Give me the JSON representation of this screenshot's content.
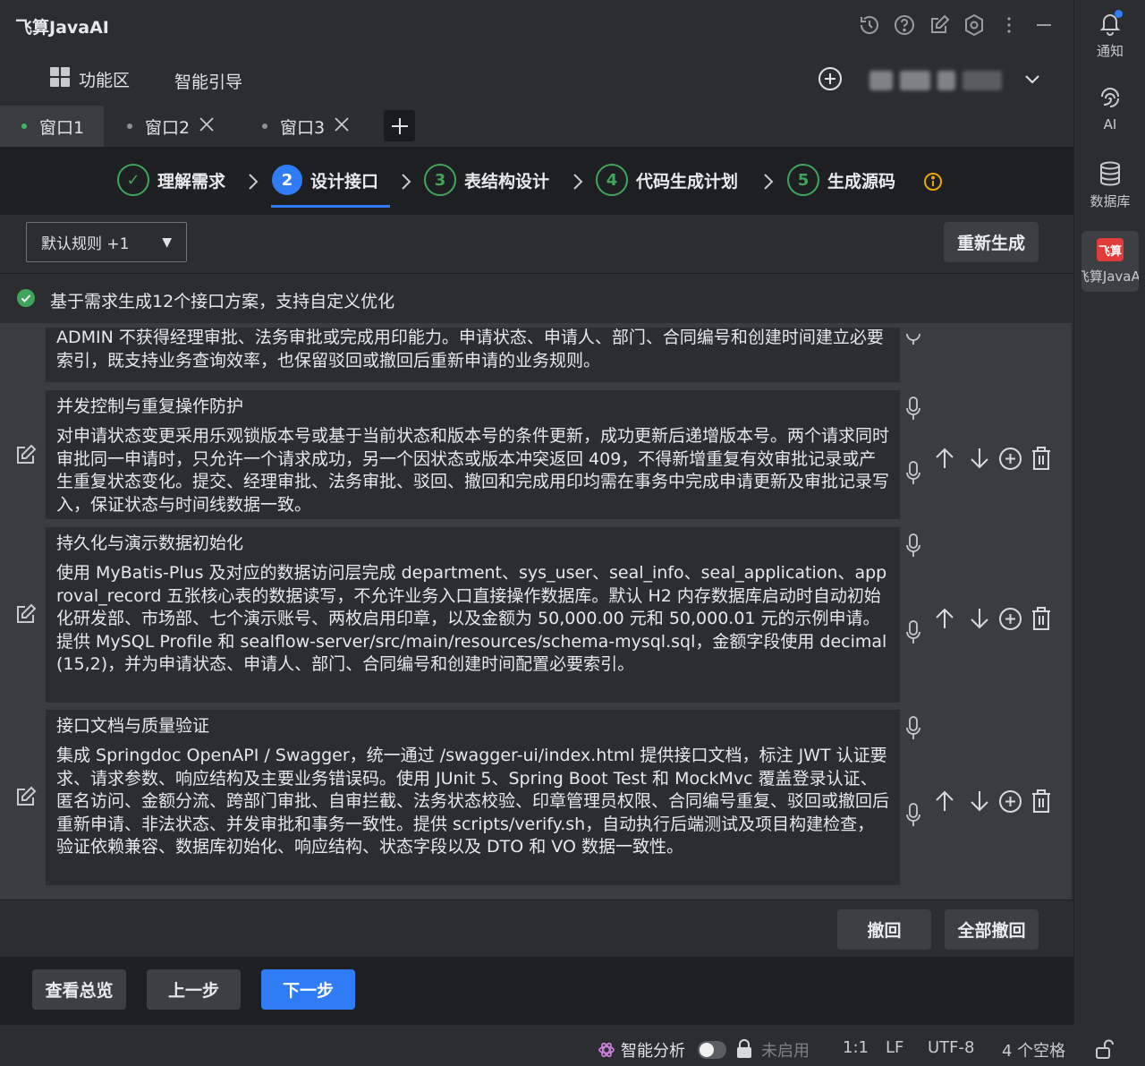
{
  "app": {
    "title": "飞算JavaAI"
  },
  "toolbar": {
    "func_area": "功能区",
    "smart_guide": "智能引导"
  },
  "tabs": [
    {
      "label": "窗口1",
      "active": true
    },
    {
      "label": "窗口2",
      "active": false
    },
    {
      "label": "窗口3",
      "active": false
    }
  ],
  "steps": [
    {
      "num": "✓",
      "label": "理解需求"
    },
    {
      "num": "2",
      "label": "设计接口"
    },
    {
      "num": "3",
      "label": "表结构设计"
    },
    {
      "num": "4",
      "label": "代码生成计划"
    },
    {
      "num": "5",
      "label": "生成源码"
    }
  ],
  "rules": {
    "select_value": "默认规则 +1",
    "regen_label": "重新生成"
  },
  "status": {
    "message": "基于需求生成12个接口方案，支持自定义优化"
  },
  "cards": [
    {
      "title": "",
      "body": "ADMIN 不获得经理审批、法务审批或完成用印能力。申请状态、申请人、部门、合同编号和创建时间建立必要索引，既支持业务查询效率，也保留驳回或撤回后重新申请的业务规则。"
    },
    {
      "title": "并发控制与重复操作防护",
      "body": "对申请状态变更采用乐观锁版本号或基于当前状态和版本号的条件更新，成功更新后递增版本号。两个请求同时审批同一申请时，只允许一个请求成功，另一个因状态或版本冲突返回 409，不得新增重复有效审批记录或产生重复状态变化。提交、经理审批、法务审批、驳回、撤回和完成用印均需在事务中完成申请更新及审批记录写入，保证状态与时间线数据一致。"
    },
    {
      "title": "持久化与演示数据初始化",
      "body": "使用 MyBatis-Plus 及对应的数据访问层完成 department、sys_user、seal_info、seal_application、approval_record 五张核心表的数据读写，不允许业务入口直接操作数据库。默认 H2 内存数据库启动时自动初始化研发部、市场部、七个演示账号、两枚启用印章，以及金额为 50,000.00 元和 50,000.01 元的示例申请。提供 MySQL Profile 和 sealflow-server/src/main/resources/schema-mysql.sql，金额字段使用 decimal(15,2)，并为申请状态、申请人、部门、合同编号和创建时间配置必要索引。"
    },
    {
      "title": "接口文档与质量验证",
      "body": "集成 Springdoc OpenAPI / Swagger，统一通过 /swagger-ui/index.html 提供接口文档，标注 JWT 认证要求、请求参数、响应结构及主要业务错误码。使用 JUnit 5、Spring Boot Test 和 MockMvc 覆盖登录认证、匿名访问、金额分流、跨部门审批、自审拦截、法务状态校验、印章管理员权限、合同编号重复、驳回或撤回后重新申请、非法状态、并发审批和事务一致性。提供 scripts/verify.sh，自动执行后端测试及项目构建检查，验证依赖兼容、数据库初始化、响应结构、状态字段以及 DTO 和 VO 数据一致性。"
    }
  ],
  "bottom": {
    "undo": "撤回",
    "undo_all": "全部撤回"
  },
  "nav": {
    "overview": "查看总览",
    "prev": "上一步",
    "next": "下一步"
  },
  "statusbar": {
    "smart_analysis": "智能分析",
    "disabled": "未启用",
    "position": "1:1",
    "line_sep": "LF",
    "encoding": "UTF-8",
    "indent": "4 个空格"
  },
  "sidebar": {
    "notify": "通知",
    "ai": "AI",
    "database": "数据库",
    "feisuan_logo": "飞算",
    "feisuan": "飞算JavaAI"
  },
  "colors": {
    "accent": "#2f7cf6",
    "success": "#3fa55a",
    "brand": "#e23b3b"
  }
}
